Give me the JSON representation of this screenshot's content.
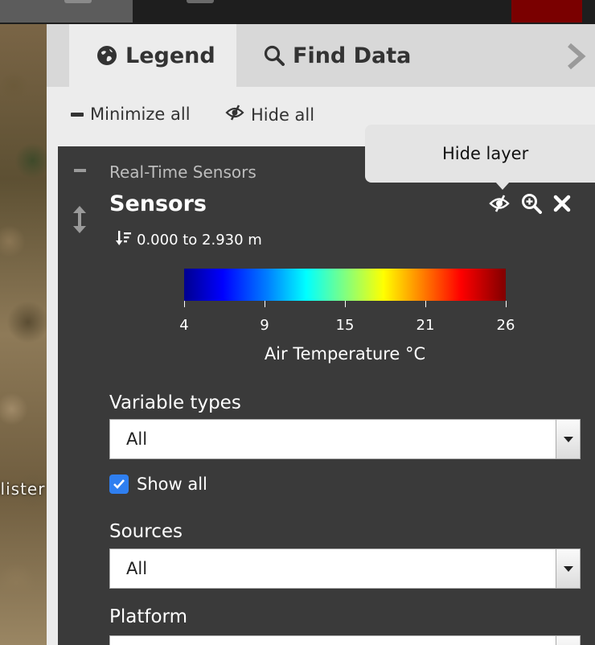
{
  "map": {
    "label": "llister"
  },
  "tabs": [
    {
      "label": "Legend",
      "icon": "globe-icon"
    },
    {
      "label": "Find Data",
      "icon": "search-icon"
    }
  ],
  "toolbar": {
    "minimize_label": "Minimize all",
    "hide_label": "Hide all"
  },
  "group": {
    "title": "Real-Time Sensors"
  },
  "layer": {
    "title": "Sensors",
    "range": "0.000 to 2.930 m",
    "icons": [
      "eye-slash-icon",
      "zoom-in-icon",
      "close-icon"
    ]
  },
  "colorbar": {
    "ticks": [
      "4",
      "9",
      "15",
      "21",
      "26"
    ],
    "title": "Air Temperature °C",
    "colors": [
      "#00008f",
      "#0000ff",
      "#00ffff",
      "#ffff00",
      "#ff0000",
      "#800000"
    ]
  },
  "filters": {
    "variable_types": {
      "label": "Variable types",
      "value": "All"
    },
    "show_all": {
      "label": "Show all",
      "checked": true
    },
    "sources": {
      "label": "Sources",
      "value": "All"
    },
    "platform": {
      "label": "Platform"
    }
  },
  "tooltip": {
    "text": "Hide layer"
  },
  "colors": {
    "accent": "#2f7ff0",
    "panel_dark": "#3a3a3a",
    "alert": "#7a0000"
  }
}
